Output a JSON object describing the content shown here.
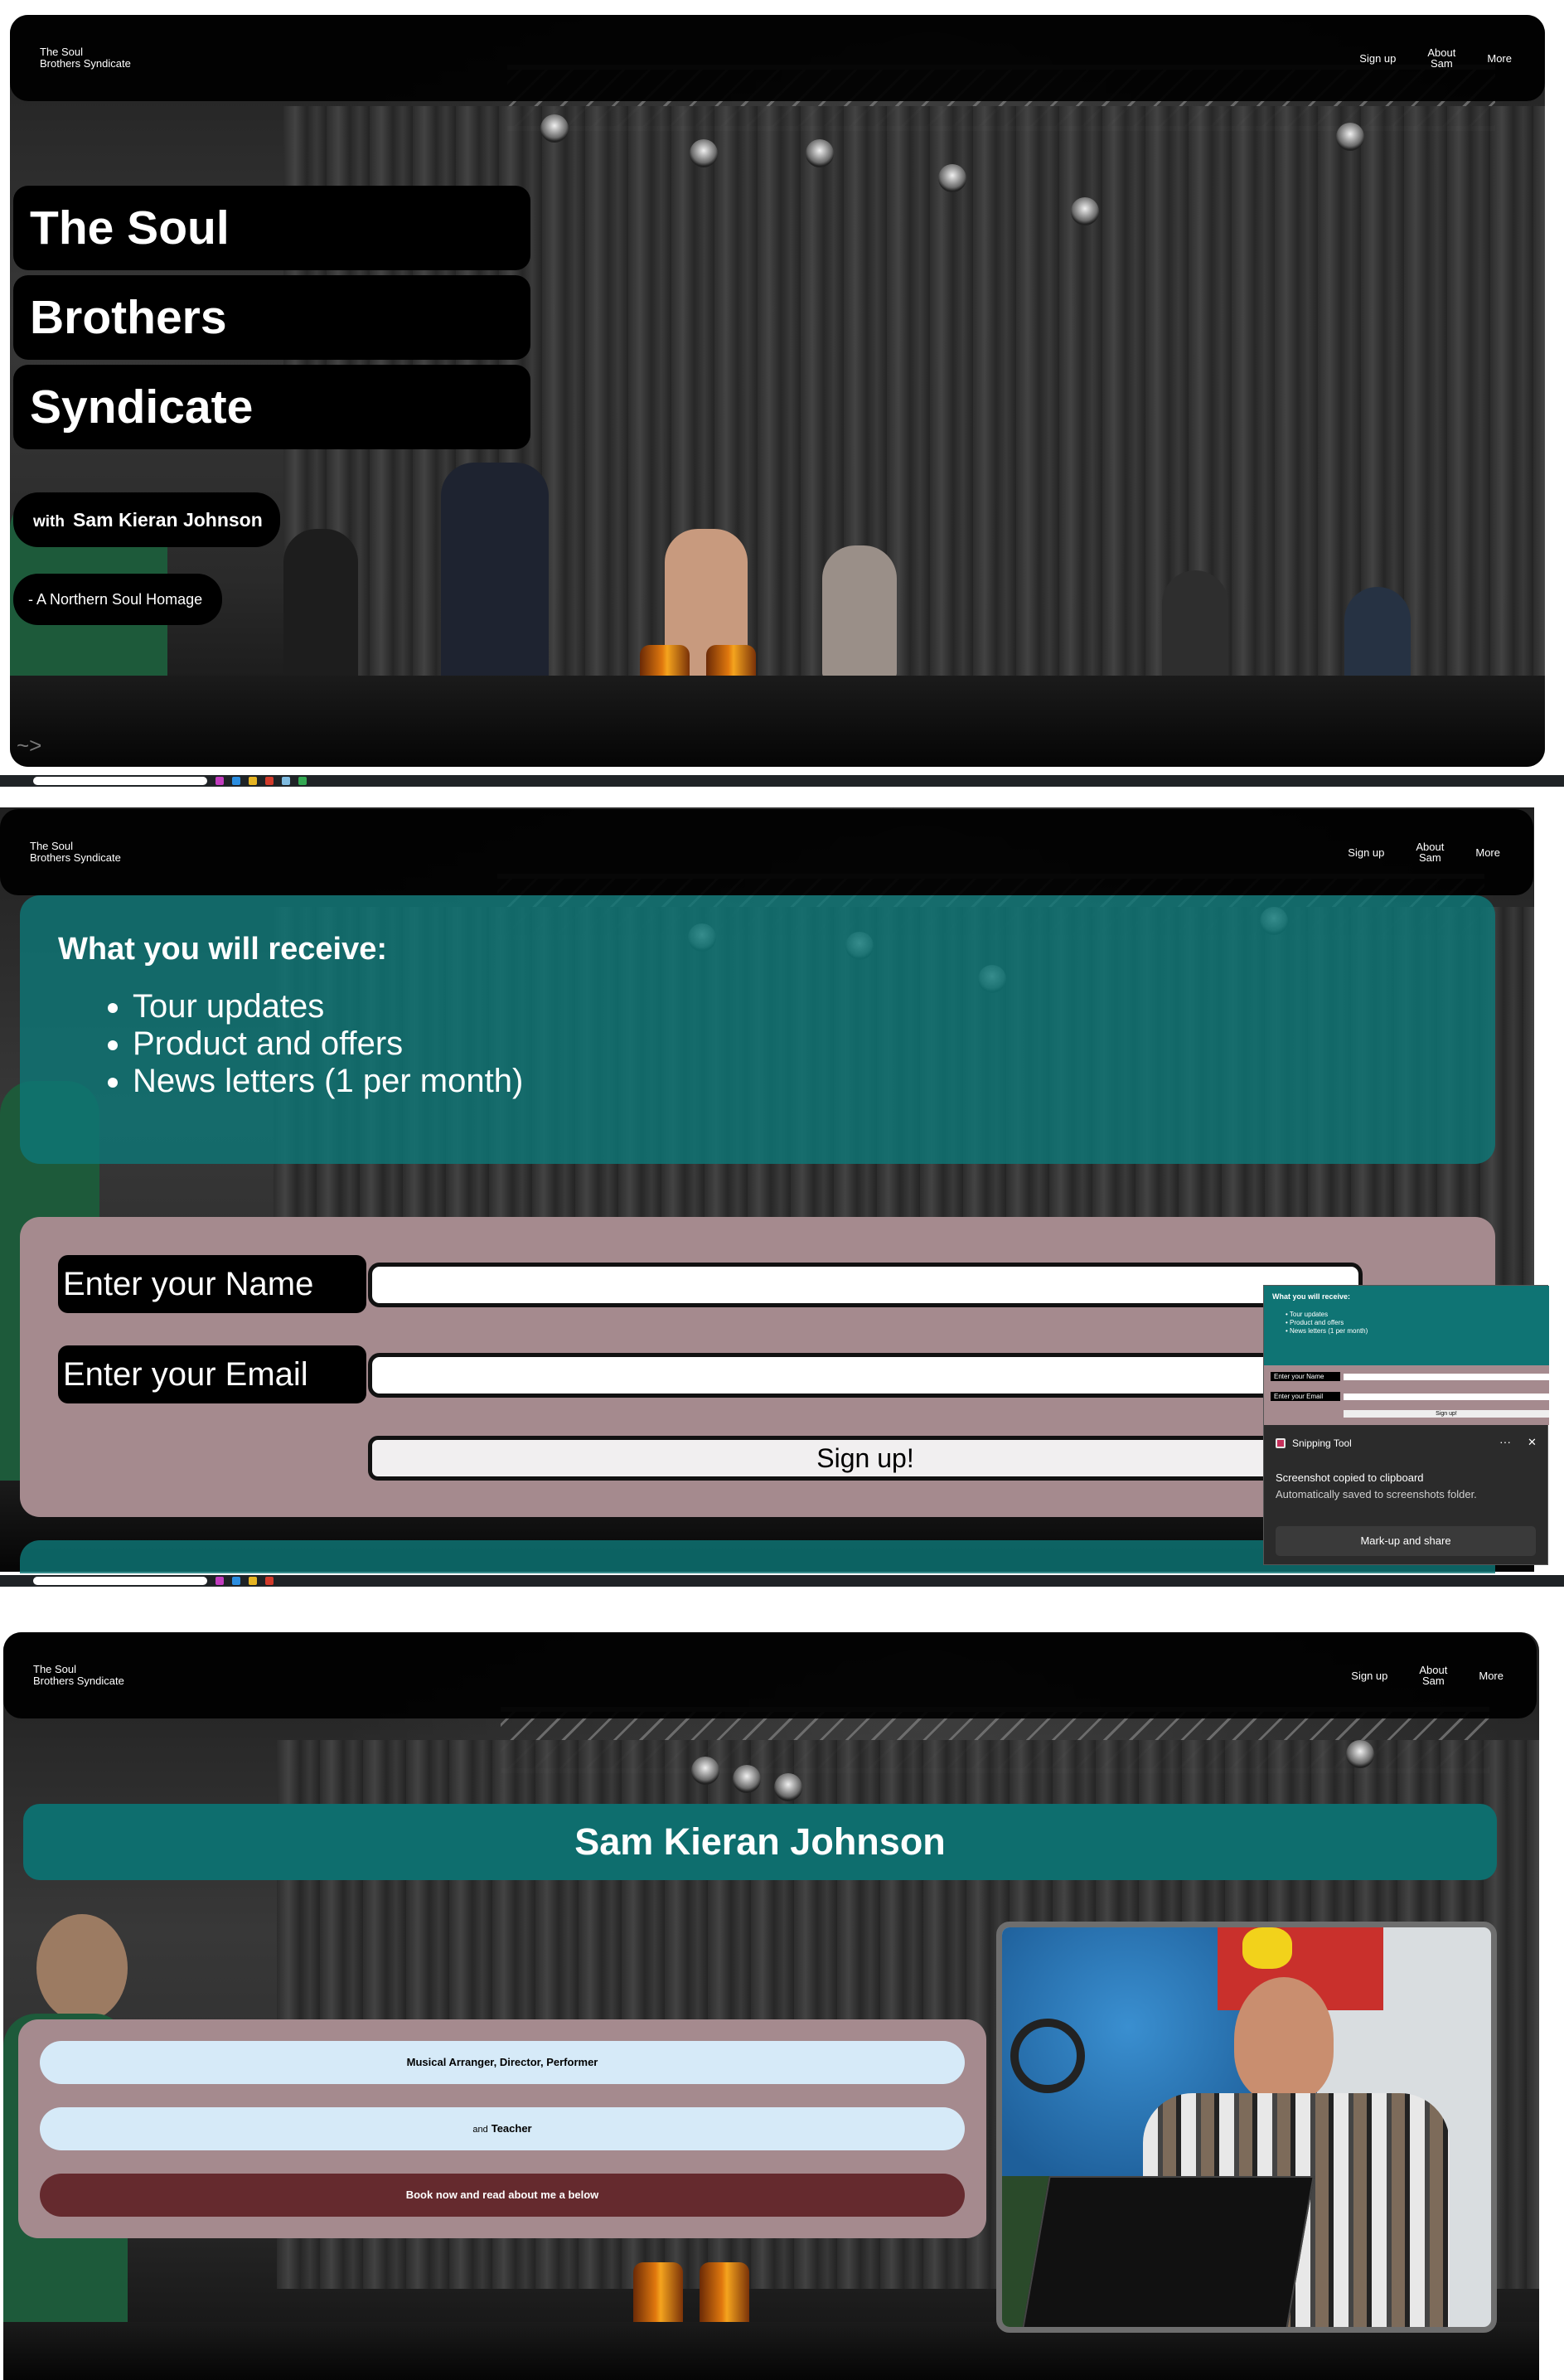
{
  "nav": {
    "logo_line1": "The Soul",
    "logo_line2": "Brothers Syndicate",
    "signup": "Sign up",
    "about_line1": "About",
    "about_line2": "Sam",
    "more": "More"
  },
  "hero": {
    "title_line1": "The Soul",
    "title_line2": "Brothers",
    "title_line3": "Syndicate",
    "with_prefix": "with",
    "with_name": "Sam Kieran Johnson",
    "tagline": "- A Northern Soul Homage",
    "corner_mark": "~>"
  },
  "signup_section": {
    "heading": "What you will receive:",
    "benefits": [
      "Tour updates",
      "Product and offers",
      "News letters (1 per month)"
    ],
    "name_label": "Enter your Name",
    "email_label": "Enter your Email",
    "submit_label": "Sign up!"
  },
  "toast": {
    "thumb_heading": "What you will receive:",
    "thumb_items": [
      "• Tour updates",
      "• Product and offers",
      "• News letters (1 per month)"
    ],
    "thumb_name": "Enter your Name",
    "thumb_email": "Enter your Email",
    "thumb_submit": "Sign up!",
    "app_name": "Snipping Tool",
    "menu_dots": "···",
    "close": "✕",
    "line1": "Screenshot copied to clipboard",
    "line2": "Automatically saved to screenshots folder.",
    "action": "Mark-up and share"
  },
  "about_section": {
    "title": "Sam Kieran Johnson",
    "role": "Musical Arranger, Director, Performer",
    "teacher_prefix": "and",
    "teacher": "Teacher",
    "cta": "Book now and read about me a below"
  },
  "colors": {
    "teal": "#0e6e6e",
    "mauve": "#a58a8e",
    "light_blue_pill": "#d6eaf8",
    "maroon_pill": "#652a2e",
    "black_pill": "#000000"
  }
}
